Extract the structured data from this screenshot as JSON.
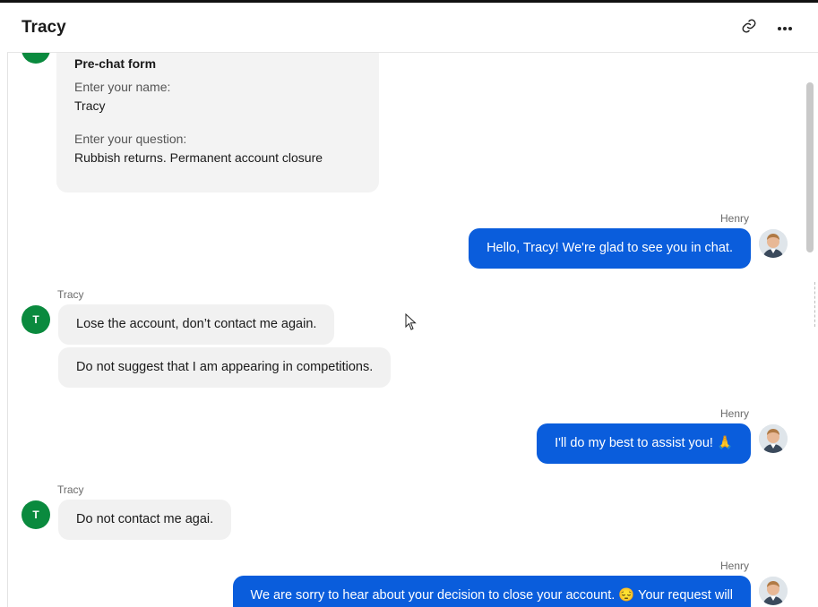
{
  "header": {
    "title": "Tracy"
  },
  "icons": {
    "link": "link-icon",
    "more": "more-horizontal-icon",
    "cursor": "mouse-pointer-icon"
  },
  "colors": {
    "accent": "#0a5ddc",
    "customer_avatar": "#0a8a3e",
    "incoming_bubble": "#f1f1f1"
  },
  "pre_chat_form": {
    "title": "Pre-chat form",
    "fields": [
      {
        "label": "Enter your name:",
        "value": "Tracy"
      },
      {
        "label": "Enter your question:",
        "value": "Rubbish returns. Permanent account closure"
      }
    ]
  },
  "messages": [
    {
      "sender": "Henry",
      "text": "Hello, Tracy! We're glad to see you in chat."
    },
    {
      "sender": "Tracy",
      "avatar_initial": "T",
      "texts": [
        "Lose the account, don’t contact me again.",
        "Do not suggest that I am appearing in competitions."
      ]
    },
    {
      "sender": "Henry",
      "text": "I'll do my best to assist you! 🙏"
    },
    {
      "sender": "Tracy",
      "avatar_initial": "T",
      "texts": [
        "Do not contact me agai."
      ]
    },
    {
      "sender": "Henry",
      "text": "We are sorry to hear about your decision to close your account. 😔 Your request will"
    }
  ]
}
